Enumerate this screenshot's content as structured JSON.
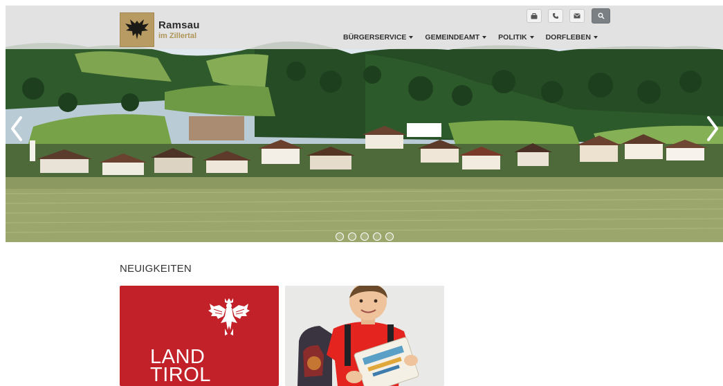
{
  "header": {
    "site_name": "Ramsau",
    "site_subtitle": "im Zillertal",
    "utility_icons": [
      "briefcase-icon",
      "phone-icon",
      "mail-icon",
      "search-icon"
    ],
    "nav": [
      {
        "label": "BÜRGERSERVICE"
      },
      {
        "label": "GEMEINDEAMT"
      },
      {
        "label": "POLITIK"
      },
      {
        "label": "DORFLEBEN"
      }
    ]
  },
  "carousel": {
    "slide_count": 5,
    "active_index": 0
  },
  "news": {
    "title": "NEUIGKEITEN",
    "cards": [
      {
        "logo_text": "LAND TIROL"
      },
      {}
    ]
  },
  "colors": {
    "tirol_red": "#c2212a",
    "logo_gold": "#b79b63"
  }
}
